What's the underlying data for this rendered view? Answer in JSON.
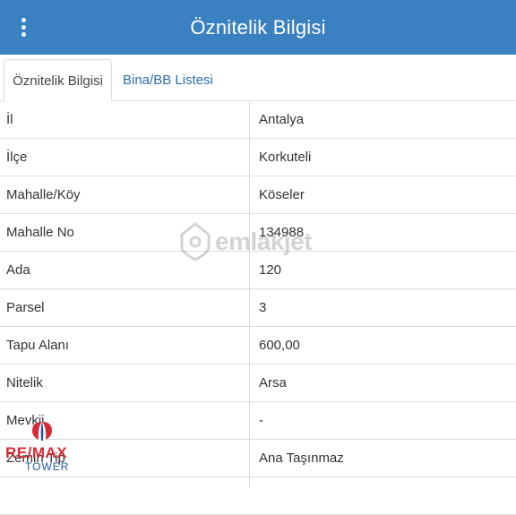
{
  "header": {
    "title": "Öznitelik Bilgisi",
    "menu_icon": "vertical-dots-icon"
  },
  "tabs": [
    {
      "label": "Öznitelik Bilgisi",
      "active": true
    },
    {
      "label": "Bina/BB Listesi",
      "active": false
    }
  ],
  "rows": [
    {
      "key": "İl",
      "value": "Antalya"
    },
    {
      "key": "İlçe",
      "value": "Korkuteli"
    },
    {
      "key": "Mahalle/Köy",
      "value": "Köseler"
    },
    {
      "key": "Mahalle No",
      "value": "134988"
    },
    {
      "key": "Ada",
      "value": "120"
    },
    {
      "key": "Parsel",
      "value": "3"
    },
    {
      "key": "Tapu Alanı",
      "value": "600,00"
    },
    {
      "key": "Nitelik",
      "value": "Arsa"
    },
    {
      "key": "Mevkii",
      "value": "-"
    },
    {
      "key": "Zemin Tip",
      "value": "Ana Taşınmaz"
    },
    {
      "key": "",
      "value": ""
    }
  ],
  "watermark": {
    "text": "emlakjet"
  },
  "logo": {
    "line1": "RE/MAX",
    "line2": "TOWER"
  },
  "colors": {
    "header_bg": "#3a81c2",
    "link": "#2a6eb0",
    "border": "#dddddd"
  }
}
